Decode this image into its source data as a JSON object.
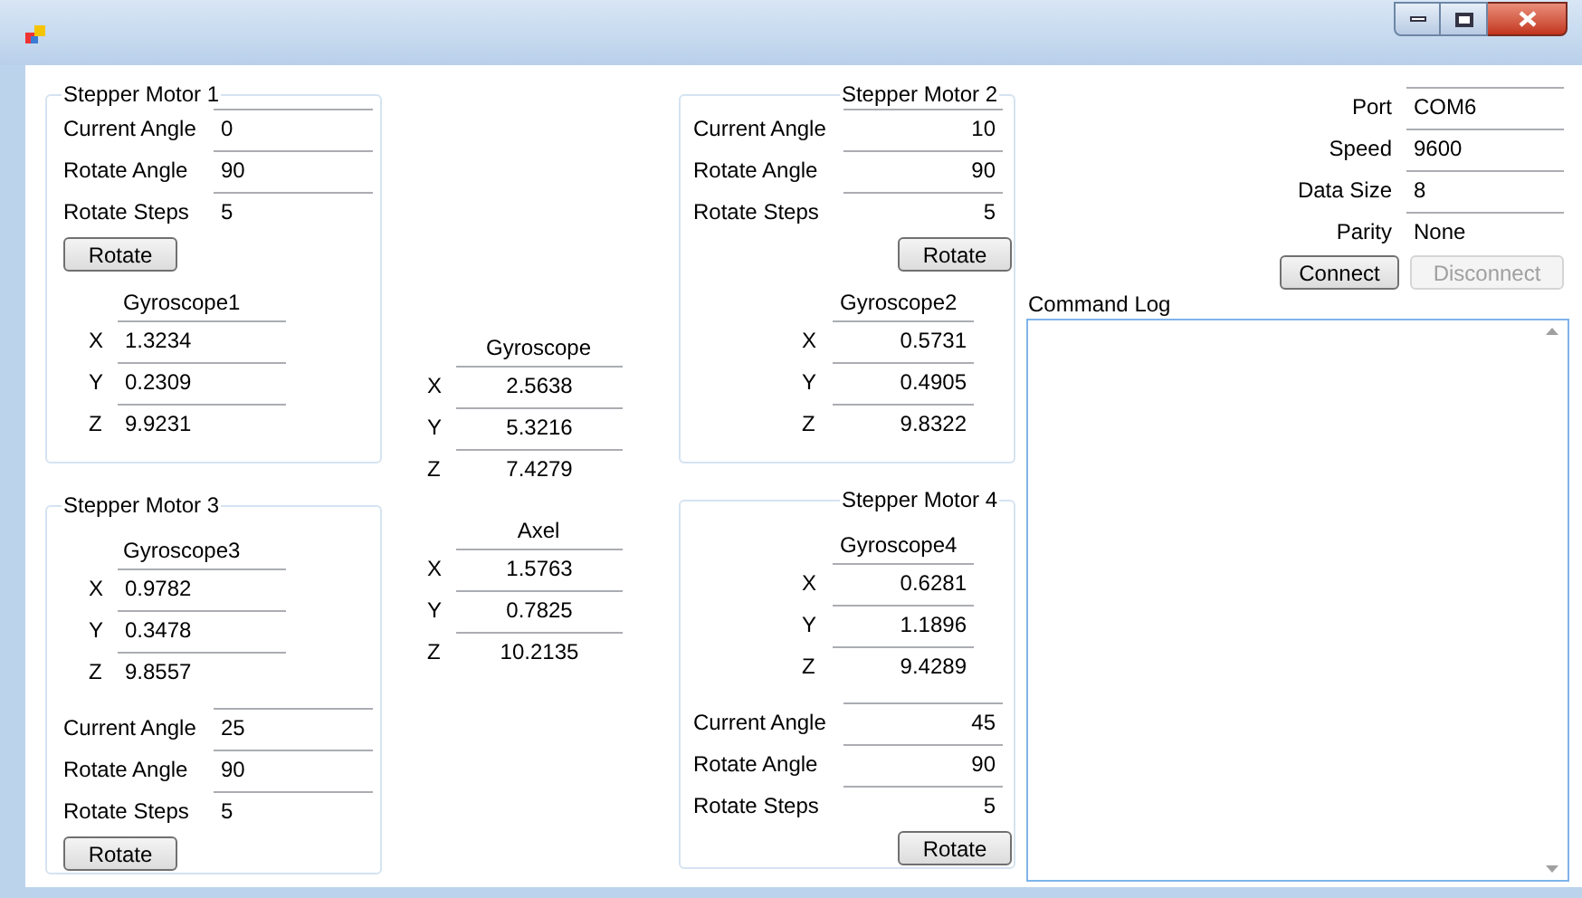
{
  "motors": [
    {
      "title": "Stepper Motor 1",
      "kind": "upper",
      "fields": [
        {
          "label": "Current Angle",
          "value": "0"
        },
        {
          "label": "Rotate Angle",
          "value": "90"
        },
        {
          "label": "Rotate Steps",
          "value": "5"
        }
      ],
      "button": "Rotate",
      "gyro": {
        "title": "Gyroscope1",
        "rows": [
          {
            "axis": "X",
            "value": "1.3234"
          },
          {
            "axis": "Y",
            "value": "0.2309"
          },
          {
            "axis": "Z",
            "value": "9.9231"
          }
        ]
      }
    },
    {
      "title": "Stepper Motor 2",
      "kind": "upper",
      "fields": [
        {
          "label": "Current Angle",
          "value": "10"
        },
        {
          "label": "Rotate Angle",
          "value": "90"
        },
        {
          "label": "Rotate Steps",
          "value": "5"
        }
      ],
      "button": "Rotate",
      "gyro": {
        "title": "Gyroscope2",
        "rows": [
          {
            "axis": "X",
            "value": "0.5731"
          },
          {
            "axis": "Y",
            "value": "0.4905"
          },
          {
            "axis": "Z",
            "value": "9.8322"
          }
        ]
      }
    },
    {
      "title": "Stepper Motor 3",
      "kind": "lower",
      "fields": [
        {
          "label": "Current Angle",
          "value": "25"
        },
        {
          "label": "Rotate Angle",
          "value": "90"
        },
        {
          "label": "Rotate Steps",
          "value": "5"
        }
      ],
      "button": "Rotate",
      "gyro": {
        "title": "Gyroscope3",
        "rows": [
          {
            "axis": "X",
            "value": "0.9782"
          },
          {
            "axis": "Y",
            "value": "0.3478"
          },
          {
            "axis": "Z",
            "value": "9.8557"
          }
        ]
      }
    },
    {
      "title": "Stepper Motor 4",
      "kind": "lower",
      "fields": [
        {
          "label": "Current Angle",
          "value": "45"
        },
        {
          "label": "Rotate Angle",
          "value": "90"
        },
        {
          "label": "Rotate Steps",
          "value": "5"
        }
      ],
      "button": "Rotate",
      "gyro": {
        "title": "Gyroscope4",
        "rows": [
          {
            "axis": "X",
            "value": "0.6281"
          },
          {
            "axis": "Y",
            "value": "1.1896"
          },
          {
            "axis": "Z",
            "value": "9.4289"
          }
        ]
      }
    }
  ],
  "sensors": [
    {
      "title": "Gyroscope",
      "rows": [
        {
          "axis": "X",
          "value": "2.5638"
        },
        {
          "axis": "Y",
          "value": "5.3216"
        },
        {
          "axis": "Z",
          "value": "7.4279"
        }
      ]
    },
    {
      "title": "Axel",
      "rows": [
        {
          "axis": "X",
          "value": "1.5763"
        },
        {
          "axis": "Y",
          "value": "0.7825"
        },
        {
          "axis": "Z",
          "value": "10.2135"
        }
      ]
    }
  ],
  "connection": {
    "fields": [
      {
        "label": "Port",
        "value": "COM6"
      },
      {
        "label": "Speed",
        "value": "9600"
      },
      {
        "label": "Data Size",
        "value": "8"
      },
      {
        "label": "Parity",
        "value": "None"
      }
    ],
    "buttons": [
      {
        "label": "Connect",
        "disabled": false
      },
      {
        "label": "Disconnect",
        "disabled": true
      }
    ]
  },
  "command_log": {
    "label": "Command Log"
  }
}
